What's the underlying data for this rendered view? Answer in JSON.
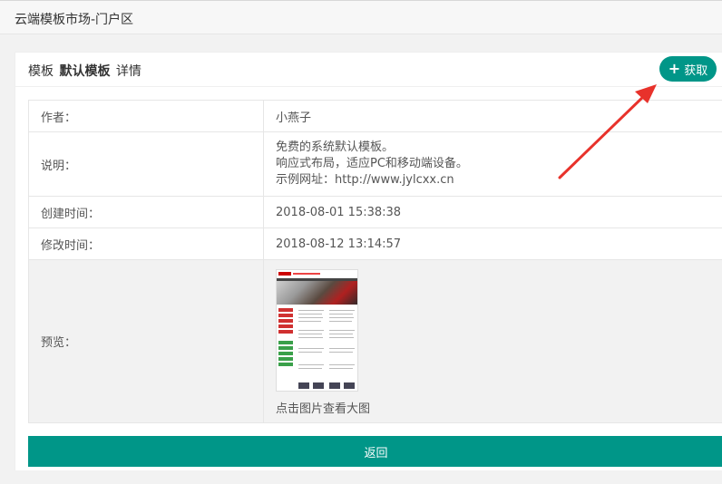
{
  "topbar": {
    "title": "云端模板市场-门户区"
  },
  "card": {
    "title_prefix": "模板",
    "title_name": "默认模板",
    "title_suffix": "详情",
    "get_button": {
      "icon": "plus-icon",
      "label": "获取"
    }
  },
  "details": {
    "author": {
      "label": "作者：",
      "value": "小燕子"
    },
    "description": {
      "label": "说明：",
      "lines": [
        "免费的系统默认模板。",
        "响应式布局，适应PC和移动端设备。",
        "示例网址：http://www.jylcxx.cn"
      ]
    },
    "created": {
      "label": "创建时间：",
      "value": "2018-08-01 15:38:38"
    },
    "modified": {
      "label": "修改时间：",
      "value": "2018-08-12 13:14:57"
    },
    "preview": {
      "label": "预览：",
      "caption": "点击图片查看大图"
    }
  },
  "back_button": {
    "label": "返回"
  },
  "colors": {
    "accent": "#009688",
    "annotation_arrow": "#e8322b"
  }
}
